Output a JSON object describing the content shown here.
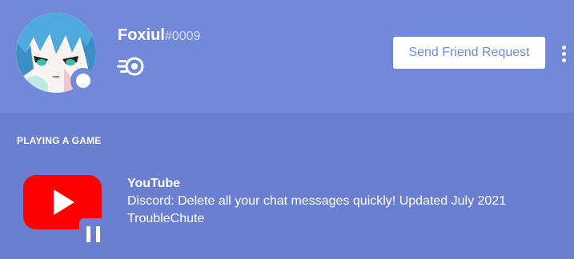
{
  "profile": {
    "username": "Foxiul",
    "discriminator": "#0009",
    "avatar_icon": "avatar-icon",
    "status": "online",
    "badge_icon": "hypesquad-badge-icon"
  },
  "actions": {
    "friend_request_label": "Send Friend Request",
    "more_icon": "more-vertical-icon"
  },
  "activity": {
    "section_title": "PLAYING A GAME",
    "app_icon": "youtube-icon",
    "state_icon": "pause-icon",
    "name": "YouTube",
    "details": "Discord: Delete all your chat messages quickly! Updated July 2021",
    "state": "TroubleChute"
  },
  "colors": {
    "header_bg": "#7289da",
    "body_bg": "#6a7fcf",
    "button_text": "#7289da",
    "youtube_red": "#ff0000"
  }
}
